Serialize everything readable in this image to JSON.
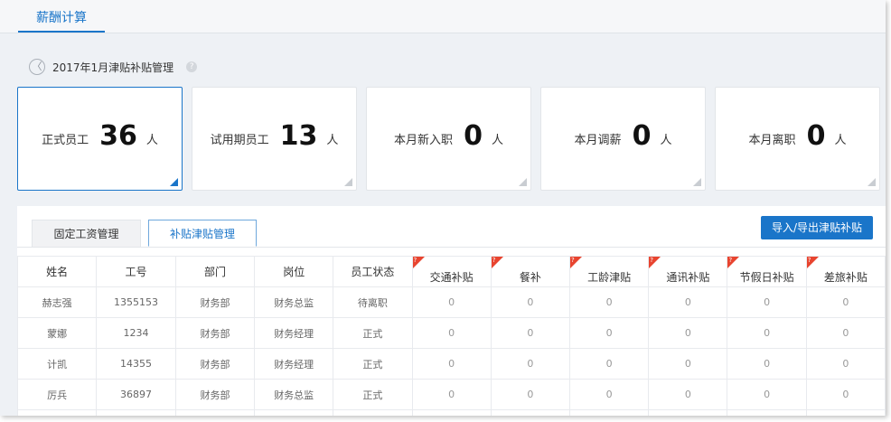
{
  "header": {
    "tab_label": "薪酬计算"
  },
  "page": {
    "back_glyph": "〈",
    "title": "2017年1月津贴补贴管理",
    "help_glyph": "?"
  },
  "stats": [
    {
      "label": "正式员工",
      "value": "36",
      "unit": "人"
    },
    {
      "label": "试用期员工",
      "value": "13",
      "unit": "人"
    },
    {
      "label": "本月新入职",
      "value": "0",
      "unit": "人"
    },
    {
      "label": "本月调薪",
      "value": "0",
      "unit": "人"
    },
    {
      "label": "本月离职",
      "value": "0",
      "unit": "人"
    }
  ],
  "subtabs": [
    {
      "label": "固定工资管理"
    },
    {
      "label": "补贴津贴管理"
    }
  ],
  "toolbar": {
    "import_export_label": "导入/导出津贴补贴"
  },
  "table": {
    "flag_glyph": "?",
    "columns": [
      "姓名",
      "工号",
      "部门",
      "岗位",
      "员工状态",
      "交通补贴",
      "餐补",
      "工龄津贴",
      "通讯补贴",
      "节假日补贴",
      "差旅补贴"
    ],
    "rows": [
      [
        "赫志强",
        "1355153",
        "财务部",
        "财务总监",
        "待离职",
        "0",
        "0",
        "0",
        "0",
        "0",
        "0"
      ],
      [
        "蒙娜",
        "1234",
        "财务部",
        "财务经理",
        "正式",
        "0",
        "0",
        "0",
        "0",
        "0",
        "0"
      ],
      [
        "计凯",
        "14355",
        "财务部",
        "财务经理",
        "正式",
        "0",
        "0",
        "0",
        "0",
        "0",
        "0"
      ],
      [
        "厉兵",
        "36897",
        "财务部",
        "财务总监",
        "正式",
        "0",
        "0",
        "0",
        "0",
        "0",
        "0"
      ],
      [
        "",
        "",
        "",
        "",
        "",
        "",
        "",
        "",
        "",
        "",
        ""
      ]
    ]
  }
}
